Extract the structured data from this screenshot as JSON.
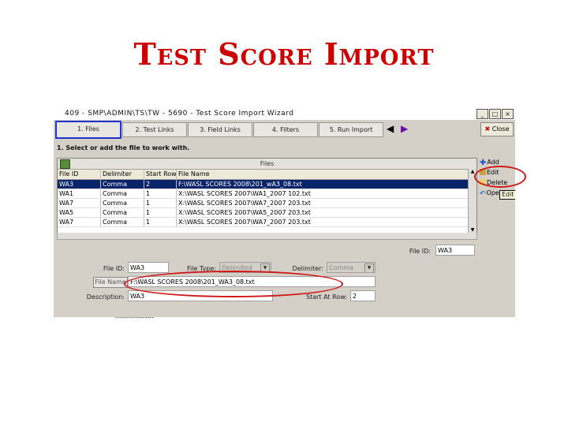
{
  "slide": {
    "title": "Test Score Import"
  },
  "window": {
    "title": "409 - SMP\\ADMIN\\TS\\TW - 5690 - Test Score Import Wizard",
    "controls": [
      "_",
      "□",
      "×"
    ]
  },
  "steps": [
    {
      "label": "1. Files"
    },
    {
      "label": "2. Test Links"
    },
    {
      "label": "3. Field Links"
    },
    {
      "label": "4. Filters"
    },
    {
      "label": "5. Run Import"
    }
  ],
  "close_label": "Close",
  "instruction": "1. Select or add the file to work with.",
  "grid": {
    "caption": "Files",
    "columns": [
      "File ID",
      "Delimiter",
      "Start Row",
      "File Name"
    ],
    "rows": [
      [
        "WA3",
        "Comma",
        "2",
        "F:\\WASL SCORES 2008\\201_wA3_08.txt"
      ],
      [
        "WA1",
        "Comma",
        "1",
        "X:\\WASL SCORES 2007\\WA1_2007 102.txt"
      ],
      [
        "WA7",
        "Comma",
        "1",
        "X:\\WASL SCORES 2007\\WA7_2007 203.txt"
      ],
      [
        "WA5",
        "Comma",
        "1",
        "X:\\WASL SCORES 2007\\WA5_2007 203.txt"
      ],
      [
        "WA7",
        "Comma",
        "1",
        "X:\\WASL SCORES 2007\\WA7_2007 203.txt"
      ]
    ]
  },
  "side_buttons": [
    "Add",
    "Edit",
    "Delete",
    "Open"
  ],
  "tooltip": "Edit",
  "form": {
    "file_id_lookup_label": "File ID:",
    "file_id_lookup_value": "WA3",
    "file_id_label": "File ID:",
    "file_id_value": "WA3",
    "file_type_label": "File Type:",
    "file_type_value": "Delimited",
    "delimiter_label": "Delimiter:",
    "delimiter_value": "Comma",
    "file_name_label": "File Name",
    "file_name_value": "F:\\WASL SCORES 2008\\201_WA3_08.txt",
    "description_label": "Description:",
    "description_value": "WA3",
    "start_row_label": "Start At Row:",
    "start_row_value": "2"
  },
  "footer_dots": "-----------------",
  "colors": {
    "title": "#cc0000",
    "selection": "#0a246a",
    "highlight_oval": "#d01818",
    "step_active_border": "#2233cc"
  }
}
